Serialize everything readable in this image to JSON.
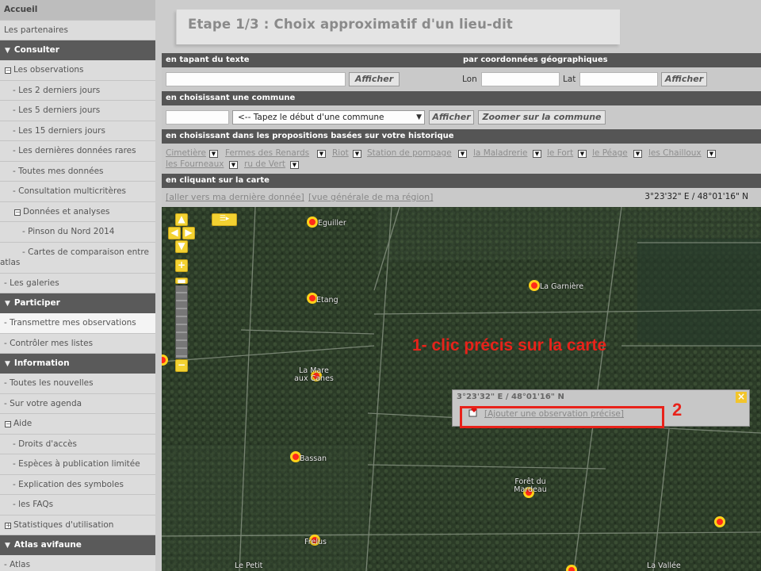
{
  "sidebar": {
    "accueil": "Accueil",
    "partenaires": "Les partenaires",
    "consulter": "Consulter",
    "observations": "Les observations",
    "d2": "- Les 2 derniers jours",
    "d5": "- Les 5 derniers jours",
    "d15": "- Les 15 derniers jours",
    "rares": "- Les dernières données rares",
    "toutes": "- Toutes mes données",
    "multi": "- Consultation multicritères",
    "analyses": "Données et analyses",
    "pinson": "- Pinson du Nord 2014",
    "cartes": "- Cartes de comparaison entre atlas",
    "galeries": "- Les galeries",
    "participer": "Participer",
    "transmettre": "- Transmettre mes observations",
    "controler": "- Contrôler mes listes",
    "information": "Information",
    "nouvelles": "- Toutes les nouvelles",
    "agenda": "- Sur votre agenda",
    "aide": "Aide",
    "droits": "- Droits d'accès",
    "especes": "- Espèces à publication limitée",
    "symboles": "- Explication des symboles",
    "faqs": "- les FAQs",
    "stats": "Statistiques d'utilisation",
    "atlas_header": "Atlas avifaune",
    "atlas": "- Atlas"
  },
  "page": {
    "title": "Etape 1/3 : Choix approximatif d'un lieu-dit"
  },
  "search_text": {
    "header": "en tapant du texte",
    "button": "Afficher"
  },
  "coords": {
    "header": "par coordonnées géographiques",
    "lon_label": "Lon",
    "lat_label": "Lat",
    "button": "Afficher"
  },
  "commune": {
    "header": "en choisissant une commune",
    "select_value": "<-- Tapez le début d'une commune",
    "show_button": "Afficher",
    "zoom_button": "Zoomer sur la commune"
  },
  "history": {
    "header": "en choisissant dans les propositions basées sur votre historique",
    "items": [
      "Cimetière",
      "Fermes des Renards",
      "Riot",
      "Station de pompage",
      "la Maladrerie",
      "le Fort",
      "le Péage",
      "les Chailloux",
      "les Fourneaux",
      "ru de Vert"
    ]
  },
  "map_section": {
    "header": "en cliquant sur la carte",
    "link_last": "[aller vers ma dernière donnée]",
    "link_region": "[vue générale de ma région]",
    "coord_readout": "3°23'32\" E / 48°01'16\" N"
  },
  "map": {
    "labels": [
      "Eguiller",
      "La Garnière",
      "Etang",
      "La Mare aux Canes",
      "Bassan",
      "Forêt du Mardeau",
      "Frelus",
      "Le Petit",
      "La Vallée"
    ],
    "popup": {
      "coord": "3°23'32\" E / 48°01'16\" N",
      "link": "[Ajouter une observation précise]"
    },
    "annotation_1": "1- clic précis sur la carte",
    "annotation_2": "2"
  },
  "colors": {
    "annotation": "#e8221a",
    "marker_fill": "#ff2a1a",
    "marker_ring": "#ffd21a",
    "header_bar": "#555555"
  }
}
